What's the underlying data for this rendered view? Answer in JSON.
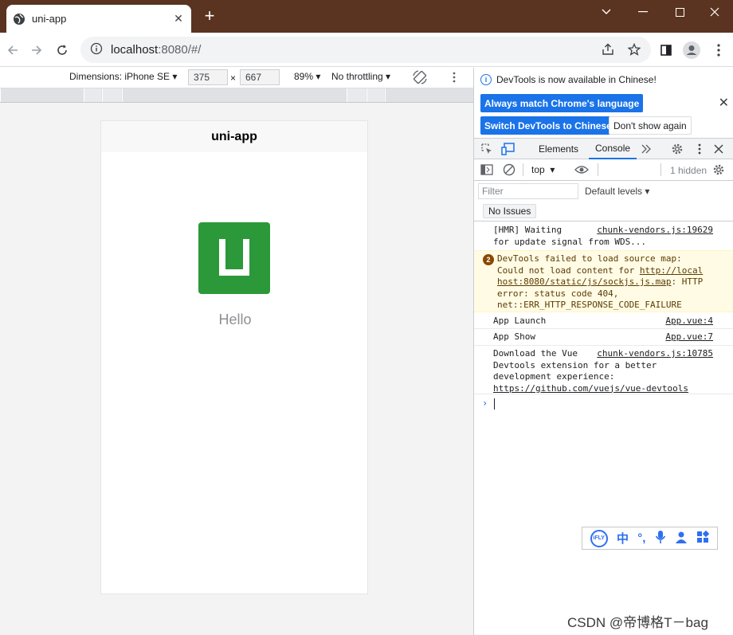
{
  "browser": {
    "tab_title": "uni-app",
    "new_tab_symbol": "+",
    "url_host": "localhost",
    "url_rest": ":8080/#/"
  },
  "device_toolbar": {
    "dimensions_label": "Dimensions: iPhone SE",
    "width": "375",
    "times": "×",
    "height": "667",
    "zoom": "89%",
    "throttling": "No throttling"
  },
  "app": {
    "nav_title": "uni-app",
    "hello_text": "Hello",
    "logo_color": "#2b9939"
  },
  "devtools": {
    "info_text": "DevTools is now available in Chinese!",
    "btn_match_language": "Always match Chrome's language",
    "btn_switch_chinese": "Switch DevTools to Chinese",
    "btn_dont_show": "Don't show again",
    "tabs": [
      "Elements",
      "Console"
    ],
    "active_tab": "Console",
    "context": "top",
    "hidden_count": "1 hidden",
    "filter_placeholder": "Filter",
    "levels": "Default levels",
    "issues": "No Issues",
    "accent_color": "#1a73e8"
  },
  "console": {
    "logs": [
      {
        "text1": "[HMR] Waiting",
        "src": "chunk-vendors.js:19629",
        "text2": "for update signal from WDS..."
      },
      {
        "count": "2",
        "line1": "DevTools failed to load source map:",
        "line2": "Could not load content for ",
        "link": "http://local",
        "line3_link": "host:8080/static/js/sockjs.js.map",
        "line3_rest": ": HTTP",
        "line4": "error: status code 404,",
        "line5": "net::ERR_HTTP_RESPONSE_CODE_FAILURE"
      },
      {
        "text1": "App Launch",
        "src": "App.vue:4"
      },
      {
        "text1": "App Show",
        "src": "App.vue:7"
      },
      {
        "text1": "Download the Vue",
        "src": "chunk-vendors.js:10785",
        "line2": "Devtools extension for a better",
        "line3": "development experience:",
        "link": "https://github.com/vuejs/vue-devtools"
      }
    ]
  },
  "ime": {
    "ifly": "iFLY",
    "zh": "中",
    "punct": "°,"
  },
  "watermark": "CSDN @帝博格T－bag"
}
